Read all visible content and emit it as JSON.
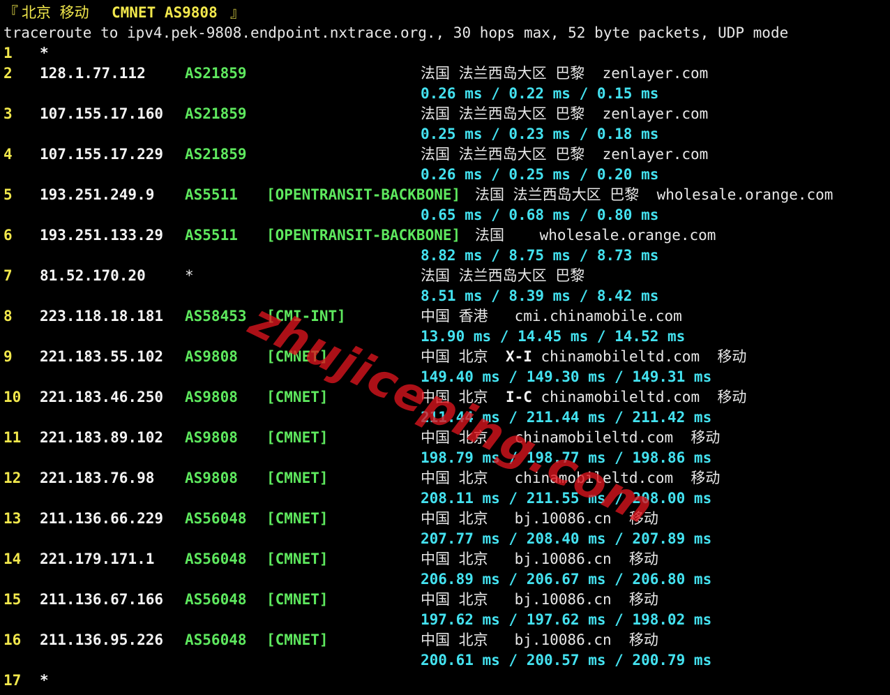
{
  "header": {
    "open_bracket": "『",
    "location": "北京 移动",
    "network": "CMNET AS9808",
    "close_bracket": "』"
  },
  "command_line": "traceroute to ipv4.pek-9808.endpoint.nxtrace.org., 30 hops max, 52 byte packets, UDP mode",
  "watermark": "zhujiceping.com",
  "colors": {
    "background": "#000000",
    "hop_number": "#f2e84c",
    "ip": "#f4f4f4",
    "asn": "#5ee85e",
    "latency": "#44e2f0",
    "watermark": "#dc141e"
  },
  "hops": [
    {
      "num": "1",
      "ip": "*",
      "asn": "",
      "tag": "",
      "geo": "",
      "times": ""
    },
    {
      "num": "2",
      "ip": "128.1.77.112",
      "asn": "AS21859",
      "tag": "",
      "geo": "法国 法兰西岛大区 巴黎  zenlayer.com",
      "times": "0.26 ms / 0.22 ms / 0.15 ms"
    },
    {
      "num": "3",
      "ip": "107.155.17.160",
      "asn": "AS21859",
      "tag": "",
      "geo": "法国 法兰西岛大区 巴黎  zenlayer.com",
      "times": "0.25 ms / 0.23 ms / 0.18 ms"
    },
    {
      "num": "4",
      "ip": "107.155.17.229",
      "asn": "AS21859",
      "tag": "",
      "geo": "法国 法兰西岛大区 巴黎  zenlayer.com",
      "times": "0.26 ms / 0.25 ms / 0.20 ms"
    },
    {
      "num": "5",
      "ip": "193.251.249.9",
      "asn": "AS5511",
      "tag": "[OPENTRANSIT-BACKBONE]",
      "geo": "法国 法兰西岛大区 巴黎  wholesale.orange.com",
      "times": "0.65 ms / 0.68 ms / 0.80 ms"
    },
    {
      "num": "6",
      "ip": "193.251.133.29",
      "asn": "AS5511",
      "tag": "[OPENTRANSIT-BACKBONE]",
      "geo": "法国    wholesale.orange.com",
      "times": "8.82 ms / 8.75 ms / 8.73 ms"
    },
    {
      "num": "7",
      "ip": "81.52.170.20",
      "asn": "*",
      "tag": "",
      "geo": "法国 法兰西岛大区 巴黎",
      "times": "8.51 ms / 8.39 ms / 8.42 ms"
    },
    {
      "num": "8",
      "ip": "223.118.18.181",
      "asn": "AS58453",
      "tag": "[CMI-INT]",
      "geo": "中国 香港   cmi.chinamobile.com",
      "times": "13.90 ms / 14.45 ms / 14.52 ms"
    },
    {
      "num": "9",
      "ip": "221.183.55.102",
      "asn": "AS9808",
      "tag": "[CMNET]",
      "geo_pre": "中国 北京  ",
      "geo_bold": "X-I",
      "geo_post": " chinamobileltd.com  移动",
      "times": "149.40 ms / 149.30 ms / 149.31 ms"
    },
    {
      "num": "10",
      "ip": "221.183.46.250",
      "asn": "AS9808",
      "tag": "[CMNET]",
      "geo_pre": "中国 北京  ",
      "geo_bold": "I-C",
      "geo_post": " chinamobileltd.com  移动",
      "times": "211.44 ms / 211.44 ms / 211.42 ms"
    },
    {
      "num": "11",
      "ip": "221.183.89.102",
      "asn": "AS9808",
      "tag": "[CMNET]",
      "geo": "中国 北京   chinamobileltd.com  移动",
      "times": "198.79 ms / 198.77 ms / 198.86 ms"
    },
    {
      "num": "12",
      "ip": "221.183.76.98",
      "asn": "AS9808",
      "tag": "[CMNET]",
      "geo": "中国 北京   chinamobileltd.com  移动",
      "times": "208.11 ms / 211.55 ms / 208.00 ms"
    },
    {
      "num": "13",
      "ip": "211.136.66.229",
      "asn": "AS56048",
      "tag": "[CMNET]",
      "geo": "中国 北京   bj.10086.cn  移动",
      "times": "207.77 ms / 208.40 ms / 207.89 ms"
    },
    {
      "num": "14",
      "ip": "221.179.171.1",
      "asn": "AS56048",
      "tag": "[CMNET]",
      "geo": "中国 北京   bj.10086.cn  移动",
      "times": "206.89 ms / 206.67 ms / 206.80 ms"
    },
    {
      "num": "15",
      "ip": "211.136.67.166",
      "asn": "AS56048",
      "tag": "[CMNET]",
      "geo": "中国 北京   bj.10086.cn  移动",
      "times": "197.62 ms / 197.62 ms / 198.02 ms"
    },
    {
      "num": "16",
      "ip": "211.136.95.226",
      "asn": "AS56048",
      "tag": "[CMNET]",
      "geo": "中国 北京   bj.10086.cn  移动",
      "times": "200.61 ms / 200.57 ms / 200.79 ms"
    },
    {
      "num": "17",
      "ip": "*",
      "asn": "",
      "tag": "",
      "geo": "",
      "times": ""
    }
  ]
}
